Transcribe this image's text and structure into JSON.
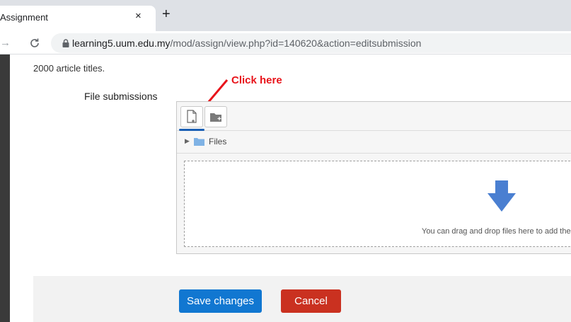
{
  "browser": {
    "tab_title": "Assignment",
    "tab_close": "×",
    "new_tab": "+",
    "url_host": "learning5.uum.edu.my",
    "url_path": "/mod/assign/view.php?id=140620&action=editsubmission"
  },
  "page": {
    "intro_text": "2000 article titles.",
    "field_label": "File submissions",
    "annotation": "Click here",
    "annotation_color": "#e8141b",
    "file_manager": {
      "path_label": "Files",
      "drop_text": "You can drag and drop files here to add them.",
      "drop_arrow_color": "#4a7fd1"
    },
    "actions": {
      "save_label": "Save changes",
      "cancel_label": "Cancel",
      "save_color": "#1177d1",
      "cancel_color": "#ca3120"
    }
  }
}
